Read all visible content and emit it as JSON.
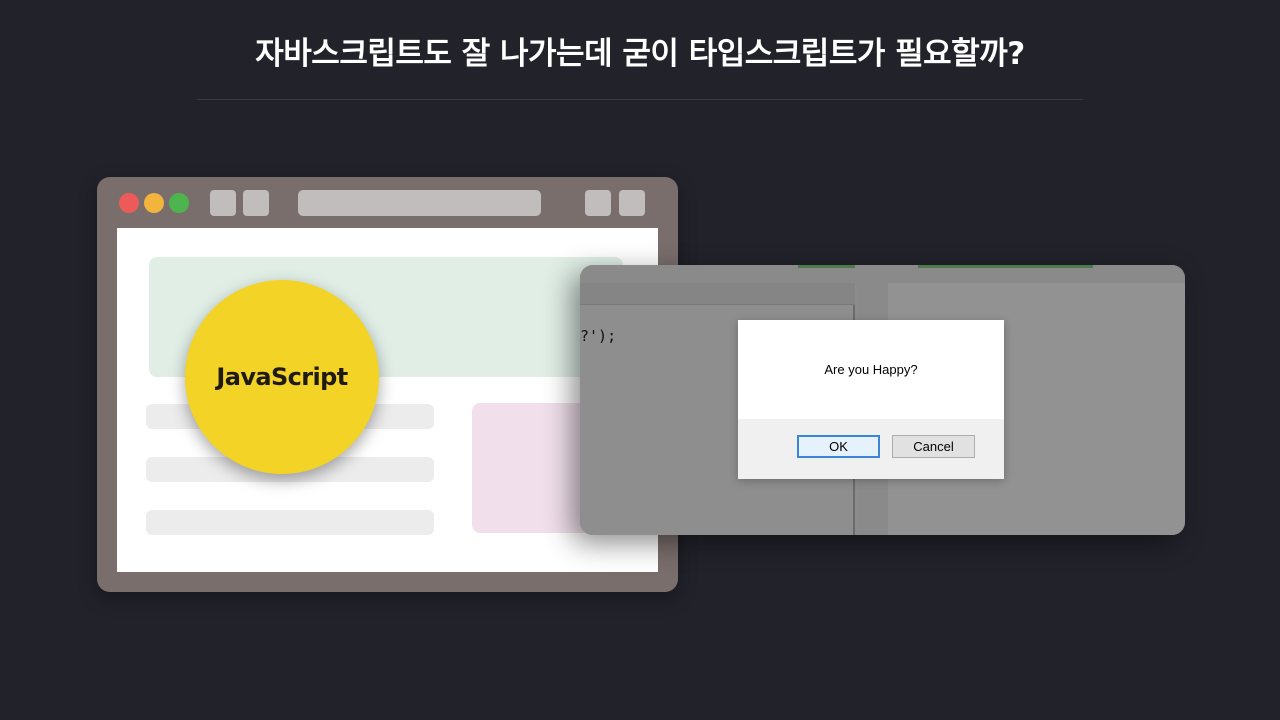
{
  "headline": "자바스크립트도 잘 나가는데 굳이 타입스크립트가 필요할까?",
  "browser_mockup": {
    "badge_label": "JavaScript",
    "colors": {
      "frame": "#7a6e6c",
      "badge": "#f3d326",
      "dot_red": "#ec5b58",
      "dot_yellow": "#f2b43c",
      "dot_green": "#4eb54e"
    }
  },
  "code_panel": {
    "snippet": "?');"
  },
  "dialog": {
    "message": "Are you Happy?",
    "ok_label": "OK",
    "cancel_label": "Cancel"
  }
}
